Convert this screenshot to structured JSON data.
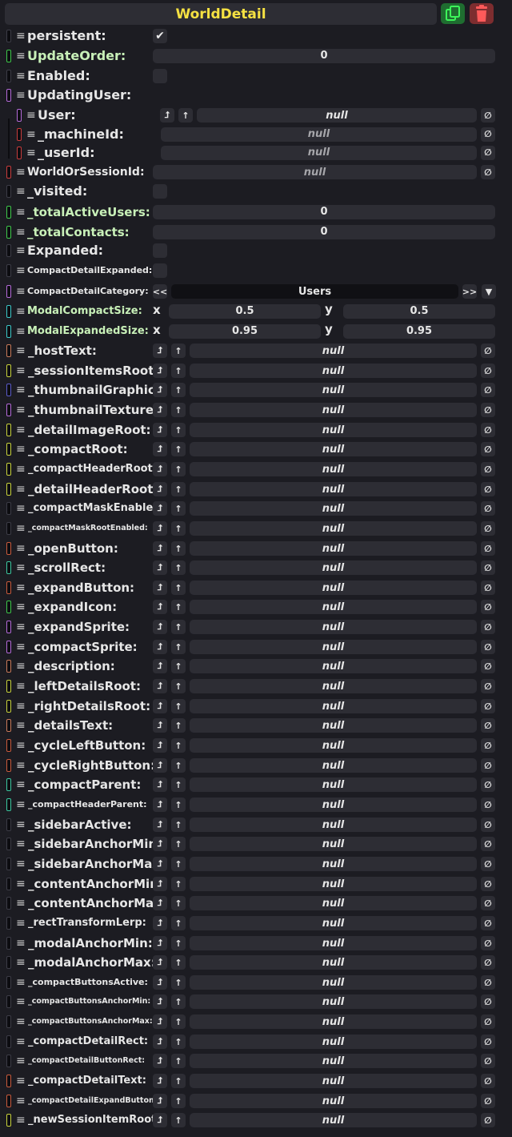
{
  "header": {
    "title": "WorldDetail",
    "duplicate_icon": "duplicate-icon",
    "delete_icon": "trash-icon",
    "colors": {
      "title": "#f5e142",
      "duplicate_bg": "#1f6d30",
      "delete_bg": "#7d2d2f"
    }
  },
  "glyphs": {
    "handle": "≡",
    "check": "✔",
    "jump": "⮥",
    "up": "↑",
    "clear": "∅",
    "prev": "<<",
    "next": ">>",
    "dropdown": "▼"
  },
  "fields": {
    "persistent": {
      "label": "persistent:",
      "checked": true
    },
    "updateOrder": {
      "label": "UpdateOrder:",
      "value": "0"
    },
    "enabled": {
      "label": "Enabled:",
      "checked": false
    },
    "updatingUser": {
      "label": "UpdatingUser:"
    },
    "user": {
      "label": "User:",
      "value": "null"
    },
    "machineId": {
      "label": "_machineId:",
      "value": "null"
    },
    "userId": {
      "label": "_userId:",
      "value": "null"
    },
    "worldOrSessionId": {
      "label": "WorldOrSessionId:",
      "value": "null"
    },
    "visited": {
      "label": "_visited:",
      "checked": false
    },
    "totalActiveUsers": {
      "label": "_totalActiveUsers:",
      "value": "0"
    },
    "totalContacts": {
      "label": "_totalContacts:",
      "value": "0"
    },
    "expanded": {
      "label": "Expanded:",
      "checked": false
    },
    "compactDetailExpanded": {
      "label": "CompactDetailExpanded:",
      "checked": false
    },
    "compactDetailCategory": {
      "label": "CompactDetailCategory:",
      "value": "Users"
    },
    "modalCompactSize": {
      "label": "ModalCompactSize:",
      "x_label": "x",
      "y_label": "y",
      "x": "0.5",
      "y": "0.5"
    },
    "modalExpandedSize": {
      "label": "ModalExpandedSize:",
      "x_label": "x",
      "y_label": "y",
      "x": "0.95",
      "y": "0.95"
    }
  },
  "refs": [
    {
      "label": "_hostText:",
      "value": "null"
    },
    {
      "label": "_sessionItemsRoot:",
      "value": "null"
    },
    {
      "label": "_thumbnailGraphic:",
      "value": "null"
    },
    {
      "label": "_thumbnailTexture:",
      "value": "null"
    },
    {
      "label": "_detailImageRoot:",
      "value": "null"
    },
    {
      "label": "_compactRoot:",
      "value": "null"
    },
    {
      "label": "_compactHeaderRoot:",
      "value": "null"
    },
    {
      "label": "_detailHeaderRoot:",
      "value": "null"
    },
    {
      "label": "_compactMaskEnabled:",
      "value": "null"
    },
    {
      "label": "_compactMaskRootEnabled:",
      "value": "null"
    },
    {
      "label": "_openButton:",
      "value": "null"
    },
    {
      "label": "_scrollRect:",
      "value": "null"
    },
    {
      "label": "_expandButton:",
      "value": "null"
    },
    {
      "label": "_expandIcon:",
      "value": "null"
    },
    {
      "label": "_expandSprite:",
      "value": "null"
    },
    {
      "label": "_compactSprite:",
      "value": "null"
    },
    {
      "label": "_description:",
      "value": "null"
    },
    {
      "label": "_leftDetailsRoot:",
      "value": "null"
    },
    {
      "label": "_rightDetailsRoot:",
      "value": "null"
    },
    {
      "label": "_detailsText:",
      "value": "null"
    },
    {
      "label": "_cycleLeftButton:",
      "value": "null"
    },
    {
      "label": "_cycleRightButton:",
      "value": "null"
    },
    {
      "label": "_compactParent:",
      "value": "null"
    },
    {
      "label": "_compactHeaderParent:",
      "value": "null"
    },
    {
      "label": "_sidebarActive:",
      "value": "null"
    },
    {
      "label": "_sidebarAnchorMin:",
      "value": "null"
    },
    {
      "label": "_sidebarAnchorMax:",
      "value": "null"
    },
    {
      "label": "_contentAnchorMin:",
      "value": "null"
    },
    {
      "label": "_contentAnchorMax:",
      "value": "null"
    },
    {
      "label": "_rectTransformLerp:",
      "value": "null"
    },
    {
      "label": "_modalAnchorMin:",
      "value": "null"
    },
    {
      "label": "_modalAnchorMax:",
      "value": "null"
    },
    {
      "label": "_compactButtonsActive:",
      "value": "null"
    },
    {
      "label": "_compactButtonsAnchorMin:",
      "value": "null"
    },
    {
      "label": "_compactButtonsAnchorMax:",
      "value": "null"
    },
    {
      "label": "_compactDetailRect:",
      "value": "null"
    },
    {
      "label": "_compactDetailButtonRect:",
      "value": "null"
    },
    {
      "label": "_compactDetailText:",
      "value": "null"
    },
    {
      "label": "_compactDetailExpandButton:",
      "value": "null"
    },
    {
      "label": "_newSessionItemRoot:",
      "value": "null"
    }
  ]
}
